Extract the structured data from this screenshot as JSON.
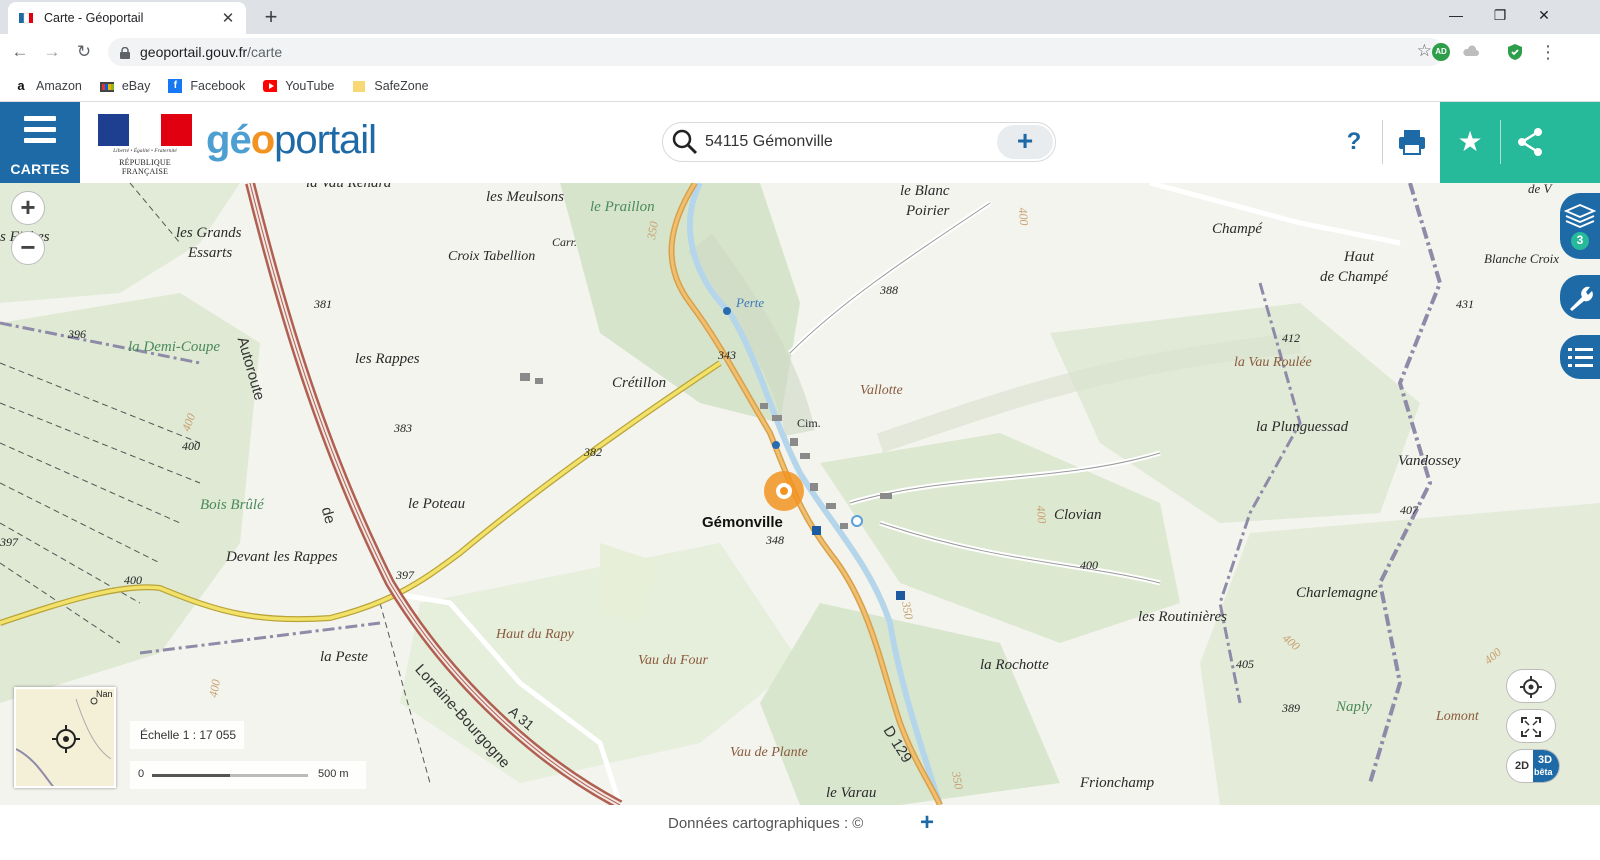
{
  "browser": {
    "tab_title": "Carte - Géoportail",
    "url_host": "geoportail.gouv.fr",
    "url_path": "/carte",
    "bookmarks": [
      {
        "label": "Amazon",
        "icon": "amazon-icon"
      },
      {
        "label": "eBay",
        "icon": "ebay-icon"
      },
      {
        "label": "Facebook",
        "icon": "facebook-icon"
      },
      {
        "label": "YouTube",
        "icon": "youtube-icon"
      },
      {
        "label": "SafeZone",
        "icon": "folder-icon"
      }
    ],
    "window_controls": [
      "minimize",
      "restore",
      "close"
    ]
  },
  "header": {
    "cartes_label": "CARTES",
    "marianne_motto": "Liberté • Égalité • Fraternité",
    "marianne_name": "RÉPUBLIQUE FRANÇAISE",
    "logo_geo_g": "g",
    "logo_geo_e": "é",
    "logo_geo_o": "o",
    "logo_portail": "portail",
    "search_value": "54115 Gémonville",
    "help_label": "?",
    "accent_color": "#1e6aa6",
    "teal_color": "#26b99a"
  },
  "map": {
    "labels": {
      "vau_renard": "la Vau Renard",
      "meulsons": "les Meulsons",
      "praillon": "le Praillon",
      "blanc_poirier_1": "le Blanc",
      "blanc_poirier_2": "Poirier",
      "champe": "Champé",
      "haut_champe_1": "Haut",
      "haut_champe_2": "de Champé",
      "blanche_croix": "Blanche Croix",
      "de_v": "de V",
      "fiches": "s Fiches",
      "grands_essarts_1": "les Grands",
      "grands_essarts_2": "Essarts",
      "croix_tabellion": "Croix Tabellion",
      "carr": "Carr.",
      "perte": "Perte",
      "autoroute": "Autoroute",
      "demi_coupe": "la Demi-Coupe",
      "rappes": "les Rappes",
      "cretillon": "Crétillon",
      "vallotte": "Vallotte",
      "cim": "Cim.",
      "vau_roulee": "la Vau Roulée",
      "plunguessad": "la Plunguessad",
      "vandossey": "Vandossey",
      "bois_brule": "Bois Brûlé",
      "le_poteau": "le Poteau",
      "de": "de",
      "gemonville": "Gémonville",
      "clovian": "Clovian",
      "devant_rappes": "Devant les Rappes",
      "charlemagne": "Charlemagne",
      "routinieres": "les Routinières",
      "haut_rapy": "Haut du Rapy",
      "la_peste": "la Peste",
      "vau_four": "Vau du Four",
      "rochotte": "la Rochotte",
      "lorraine_bourgogne": "Lorraine-Bourgogne",
      "a31": "A 31",
      "naply": "Naply",
      "lomont": "Lomont",
      "vau_plante": "Vau de Plante",
      "d129": "D 129",
      "le_varau": "le Varau",
      "frionchamp": "Frionchamp",
      "nan": "Nan"
    },
    "elevations": {
      "e381": "381",
      "e396": "396",
      "e388": "388",
      "e343": "343",
      "e431": "431",
      "e412": "412",
      "e383": "383",
      "e382": "382",
      "e400a": "400",
      "e400b": "400",
      "e397": "397",
      "e397b": "397",
      "e348": "348",
      "e400c": "400",
      "e407": "407",
      "e405": "405",
      "e389": "389",
      "e350": "350",
      "e350b": "350",
      "e400d": "400",
      "e400e": "400",
      "e400f": "400",
      "e400g": "400",
      "e350c": "350",
      "e400h": "400",
      "e400i": "400"
    },
    "layers_count": "3",
    "scale_text": "Échelle 1 : 17 055",
    "scalebar_start": "0",
    "scalebar_end": "500 m",
    "mode_2d": "2D",
    "mode_3d": "3D",
    "mode_3d_beta": "bêta"
  },
  "footer": {
    "credit": "Données cartographiques : ©",
    "plus": "+"
  }
}
